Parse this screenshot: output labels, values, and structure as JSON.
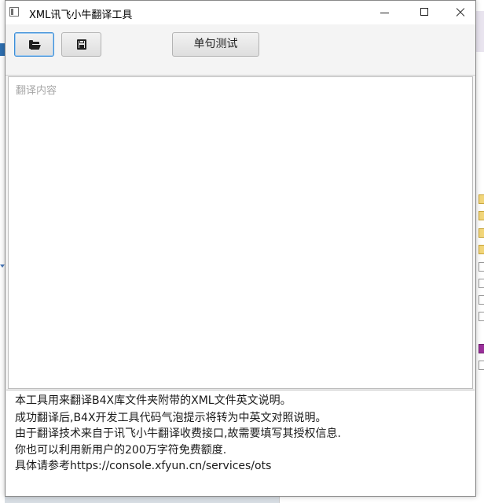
{
  "window": {
    "title": "XML讯飞小牛翻译工具"
  },
  "toolbar": {
    "open_icon": "folder-open-icon",
    "save_icon": "floppy-disk-icon",
    "test_label": "单句测试"
  },
  "content": {
    "placeholder": "翻译内容"
  },
  "description": {
    "lines": [
      "本工具用来翻译B4X库文件夹附带的XML文件英文说明。",
      "成功翻译后,B4X开发工具代码气泡提示将转为中英文对照说明。",
      "由于翻译技术来自于讯飞小牛翻译收费接口,故需要填写其授权信息.",
      "你也可以利用新用户的200万字符免费额度.",
      "具体请参考https://console.xfyun.cn/services/ots"
    ]
  }
}
